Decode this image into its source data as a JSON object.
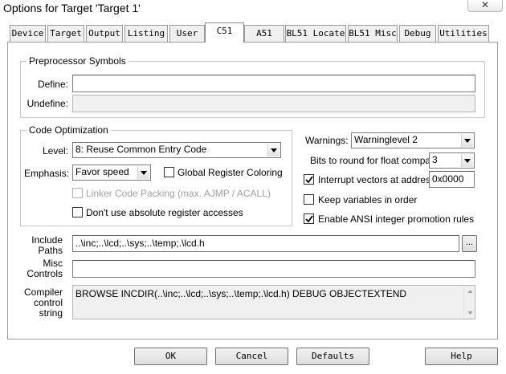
{
  "dialog": {
    "title": "Options for Target 'Target 1'",
    "close_glyph": "✕"
  },
  "tabs": [
    {
      "label": "Device"
    },
    {
      "label": "Target"
    },
    {
      "label": "Output"
    },
    {
      "label": "Listing"
    },
    {
      "label": "User"
    },
    {
      "label": "C51"
    },
    {
      "label": "A51"
    },
    {
      "label": "BL51 Locate"
    },
    {
      "label": "BL51 Misc"
    },
    {
      "label": "Debug"
    },
    {
      "label": "Utilities"
    }
  ],
  "active_tab": "C51",
  "preprocessor": {
    "legend": "Preprocessor Symbols",
    "define_label": "Define:",
    "define_value": "",
    "undefine_label": "Undefine:",
    "undefine_value": ""
  },
  "code_optimization": {
    "legend": "Code Optimization",
    "level_label": "Level:",
    "level_value": "8: Reuse Common Entry Code",
    "emphasis_label": "Emphasis:",
    "emphasis_value": "Favor speed",
    "global_register_label": "Global Register Coloring",
    "global_register_checked": false,
    "linker_packing_label": "Linker Code Packing (max. AJMP / ACALL)",
    "linker_packing_checked": false,
    "linker_packing_enabled": false,
    "no_absolute_label": "Don't use absolute register accesses",
    "no_absolute_checked": false
  },
  "right_options": {
    "warnings_label": "Warnings:",
    "warnings_value": "Warninglevel 2",
    "bits_label": "Bits to round for float compare:",
    "bits_value": "3",
    "interrupt_label": "Interrupt vectors at address:",
    "interrupt_checked": true,
    "interrupt_value": "0x0000",
    "keep_vars_label": "Keep variables in order",
    "keep_vars_checked": false,
    "ansi_label": "Enable ANSI integer promotion rules",
    "ansi_checked": true
  },
  "paths": {
    "include_label_1": "Include",
    "include_label_2": "Paths",
    "include_value": "..\\inc;..\\lcd;..\\sys;..\\temp;.\\lcd.h",
    "browse_label": "...",
    "misc_label_1": "Misc",
    "misc_label_2": "Controls",
    "misc_value": "",
    "compiler_label_1": "Compiler",
    "compiler_label_2": "control",
    "compiler_label_3": "string",
    "compiler_value": "BROWSE INCDIR(..\\inc;..\\lcd;..\\sys;..\\temp;.\\lcd.h) DEBUG OBJECTEXTEND"
  },
  "buttons": {
    "ok": "OK",
    "cancel": "Cancel",
    "defaults": "Defaults",
    "help": "Help"
  }
}
